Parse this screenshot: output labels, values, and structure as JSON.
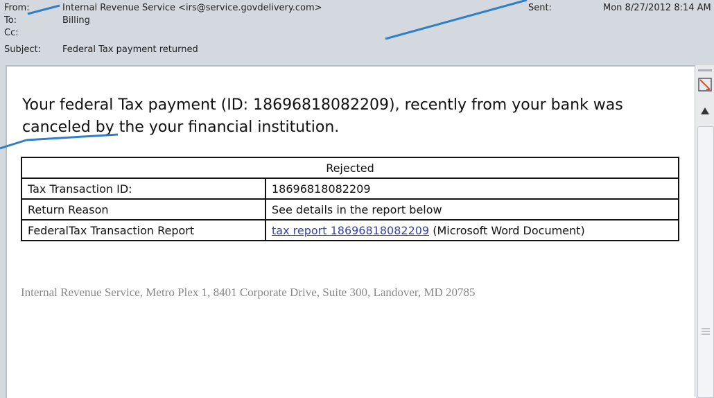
{
  "header": {
    "from_label": "From:",
    "from_value": "Internal Revenue Service <irs@service.govdelivery.com>",
    "to_label": "To:",
    "to_value": "Billing",
    "cc_label": "Cc:",
    "cc_value": "",
    "subject_label": "Subject:",
    "subject_value": "Federal Tax payment returned",
    "sent_label": "Sent:",
    "sent_value": "Mon 8/27/2012 8:14 AM"
  },
  "message": {
    "lead": "Your federal Tax payment (ID: 18696818082209), recently from your bank was canceled by the your financial institution."
  },
  "table": {
    "header": "Rejected",
    "rows": [
      {
        "label": "Tax Transaction ID:",
        "value": "18696818082209"
      },
      {
        "label": "Return Reason",
        "value": "See details in the report below"
      },
      {
        "label": "FederalTax Transaction Report",
        "link": "tax report 18696818082209",
        "suffix": " (Microsoft Word Document)"
      }
    ]
  },
  "footer": "Internal Revenue Service, Metro Plex 1, 8401 Corporate Drive, Suite 300, Landover, MD 20785",
  "colors": {
    "accent_line": "#2f7fc8",
    "link": "#3344aa",
    "header_bg": "#d3d9df"
  }
}
